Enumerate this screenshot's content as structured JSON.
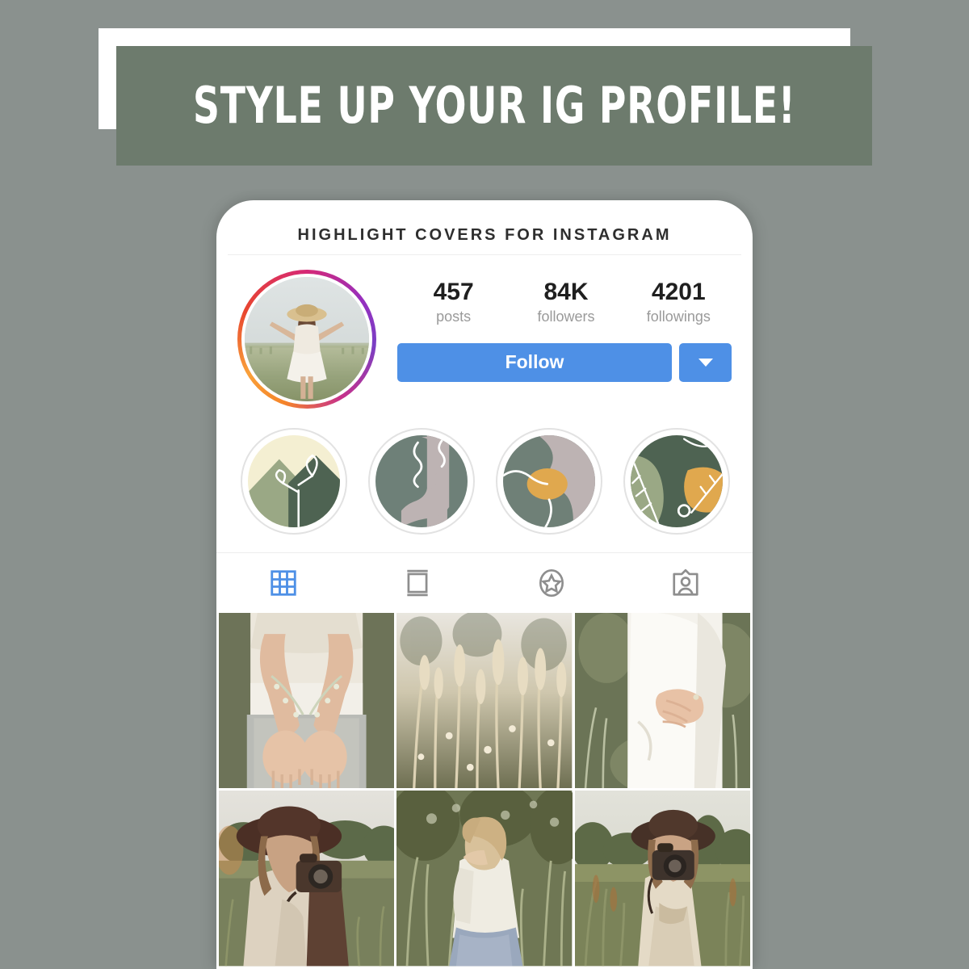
{
  "page": {
    "background_color": "#8a918e"
  },
  "banner": {
    "title": "STYLE UP YOUR IG PROFILE!",
    "green_color": "#6d7b6d",
    "white_color": "#ffffff"
  },
  "phone": {
    "header_title": "HIGHLIGHT COVERS FOR INSTAGRAM",
    "profile": {
      "avatar_alt": "woman-in-field-arms-outstretched",
      "ring_gradient": "instagram-gradient",
      "stats": [
        {
          "value": "457",
          "label": "posts"
        },
        {
          "value": "84K",
          "label": "followers"
        },
        {
          "value": "4201",
          "label": "followings"
        }
      ],
      "follow_label": "Follow",
      "follow_color": "#4e90e6",
      "dropdown_icon": "chevron-down-icon"
    },
    "highlights": [
      {
        "name": "mountain-plant-cover",
        "icon": "mountain-leaf-icon",
        "colors": {
          "bg": "#f2ecc8",
          "mid": "#9aa885",
          "dark": "#4e6352",
          "line": "#ffffff"
        }
      },
      {
        "name": "face-profile-cover",
        "icon": "face-silhouette-icon",
        "colors": {
          "bg": "#6e8078",
          "figure": "#bdb3b3",
          "line": "#ffffff"
        }
      },
      {
        "name": "abstract-blob-cover",
        "icon": "abstract-shapes-icon",
        "colors": {
          "bg": "#6f8077",
          "mauve": "#bdb3b3",
          "accent": "#e0a84e",
          "line": "#ffffff"
        }
      },
      {
        "name": "leaves-cover",
        "icon": "leaves-icon",
        "colors": {
          "bg": "#4e6352",
          "leaf": "#9aa885",
          "accent": "#e0a84e",
          "line": "#ffffff"
        }
      }
    ],
    "tabs": [
      {
        "name": "tab-grid",
        "icon": "grid-icon",
        "active": true
      },
      {
        "name": "tab-reels",
        "icon": "carousel-icon",
        "active": false
      },
      {
        "name": "tab-saved",
        "icon": "star-icon",
        "active": false
      },
      {
        "name": "tab-tagged",
        "icon": "tagged-person-icon",
        "active": false
      }
    ],
    "tab_active_color": "#4e90e6",
    "tab_inactive_color": "#8e8e8e",
    "grid_photos": [
      {
        "name": "photo-hands-behind-back",
        "alt": "woman hands clasped behind back in linen dress"
      },
      {
        "name": "photo-dried-grasses",
        "alt": "tall dried grasses close up"
      },
      {
        "name": "photo-white-blouse",
        "alt": "woman in white blouse hand on arm"
      },
      {
        "name": "photo-hat-camera-left",
        "alt": "woman in wide brim hat holding vintage camera"
      },
      {
        "name": "photo-white-sweater",
        "alt": "blonde woman in white sweater in field"
      },
      {
        "name": "photo-hat-camera-right",
        "alt": "woman in hat photographing with camera in tall grass"
      }
    ]
  }
}
